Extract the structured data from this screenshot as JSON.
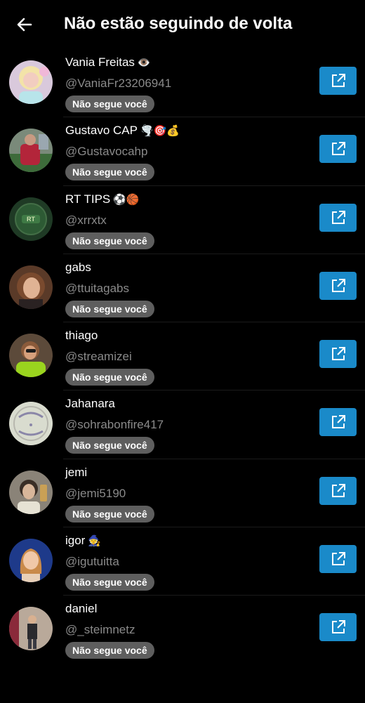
{
  "header": {
    "title": "Não estão seguindo de volta",
    "back_icon": "arrow-left-icon"
  },
  "accent_color": "#1a8ac9",
  "badge_color": "#5e5e5e",
  "users": [
    {
      "name": "Vania Freitas",
      "emoji": "👁️",
      "handle": "@VaniaFr23206941",
      "badge": "Não segue você"
    },
    {
      "name": "Gustavo CAP",
      "emoji": "🌪️🎯💰",
      "handle": "@Gustavocahp",
      "badge": "Não segue você"
    },
    {
      "name": "RT TIPS",
      "emoji": "⚽🏀",
      "handle": "@xrrxtx",
      "badge": "Não segue você"
    },
    {
      "name": "gabs",
      "emoji": "",
      "handle": "@ttuitagabs",
      "badge": "Não segue você"
    },
    {
      "name": "thiago",
      "emoji": "",
      "handle": "@streamizei",
      "badge": "Não segue você"
    },
    {
      "name": "Jahanara",
      "emoji": "",
      "handle": "@sohrabonfire417",
      "badge": "Não segue você"
    },
    {
      "name": "jemi",
      "emoji": "",
      "handle": "@jemi5190",
      "badge": "Não segue você"
    },
    {
      "name": "igor",
      "emoji": "🧙",
      "handle": "@igutuitta",
      "badge": "Não segue você"
    },
    {
      "name": "daniel",
      "emoji": "",
      "handle": "@_steimnetz",
      "badge": "Não segue você"
    }
  ],
  "open_icon": "external-link-icon"
}
